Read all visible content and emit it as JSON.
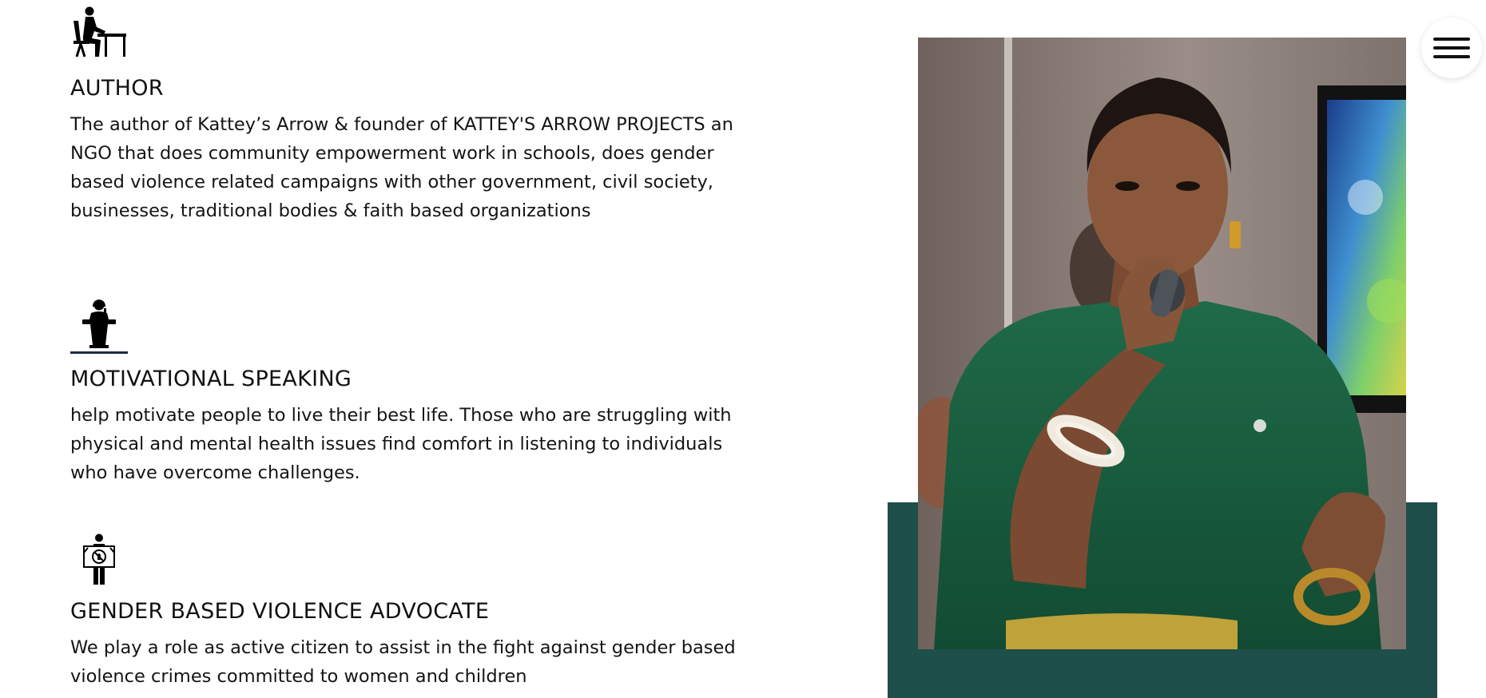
{
  "sections": [
    {
      "icon": "author-at-desk-icon",
      "title": "AUTHOR",
      "text": "The author of Kattey’s Arrow & founder of KATTEY'S ARROW PROJECTS an NGO that does community empowerment work in schools, does gender based violence related campaigns with other government, civil society, businesses, traditional bodies & faith based organizations"
    },
    {
      "icon": "speaker-at-podium-icon",
      "title": "MOTIVATIONAL SPEAKING",
      "text": "help motivate people to live their best life. Those who are struggling with physical and mental health issues find comfort in listening to individuals who have overcome challenges."
    },
    {
      "icon": "person-with-sign-icon",
      "title": "GENDER BASED VIOLENCE ADVOCATE",
      "text": "We play a role as active citizen to assist in the fight against gender based violence crimes committed to women and children"
    }
  ],
  "menu": {
    "icon": "hamburger-menu-icon"
  },
  "colors": {
    "accent_block": "#1e4f4a",
    "text": "#111111",
    "background": "#ffffff"
  },
  "photo": {
    "subject": "woman-speaking-into-microphone"
  }
}
